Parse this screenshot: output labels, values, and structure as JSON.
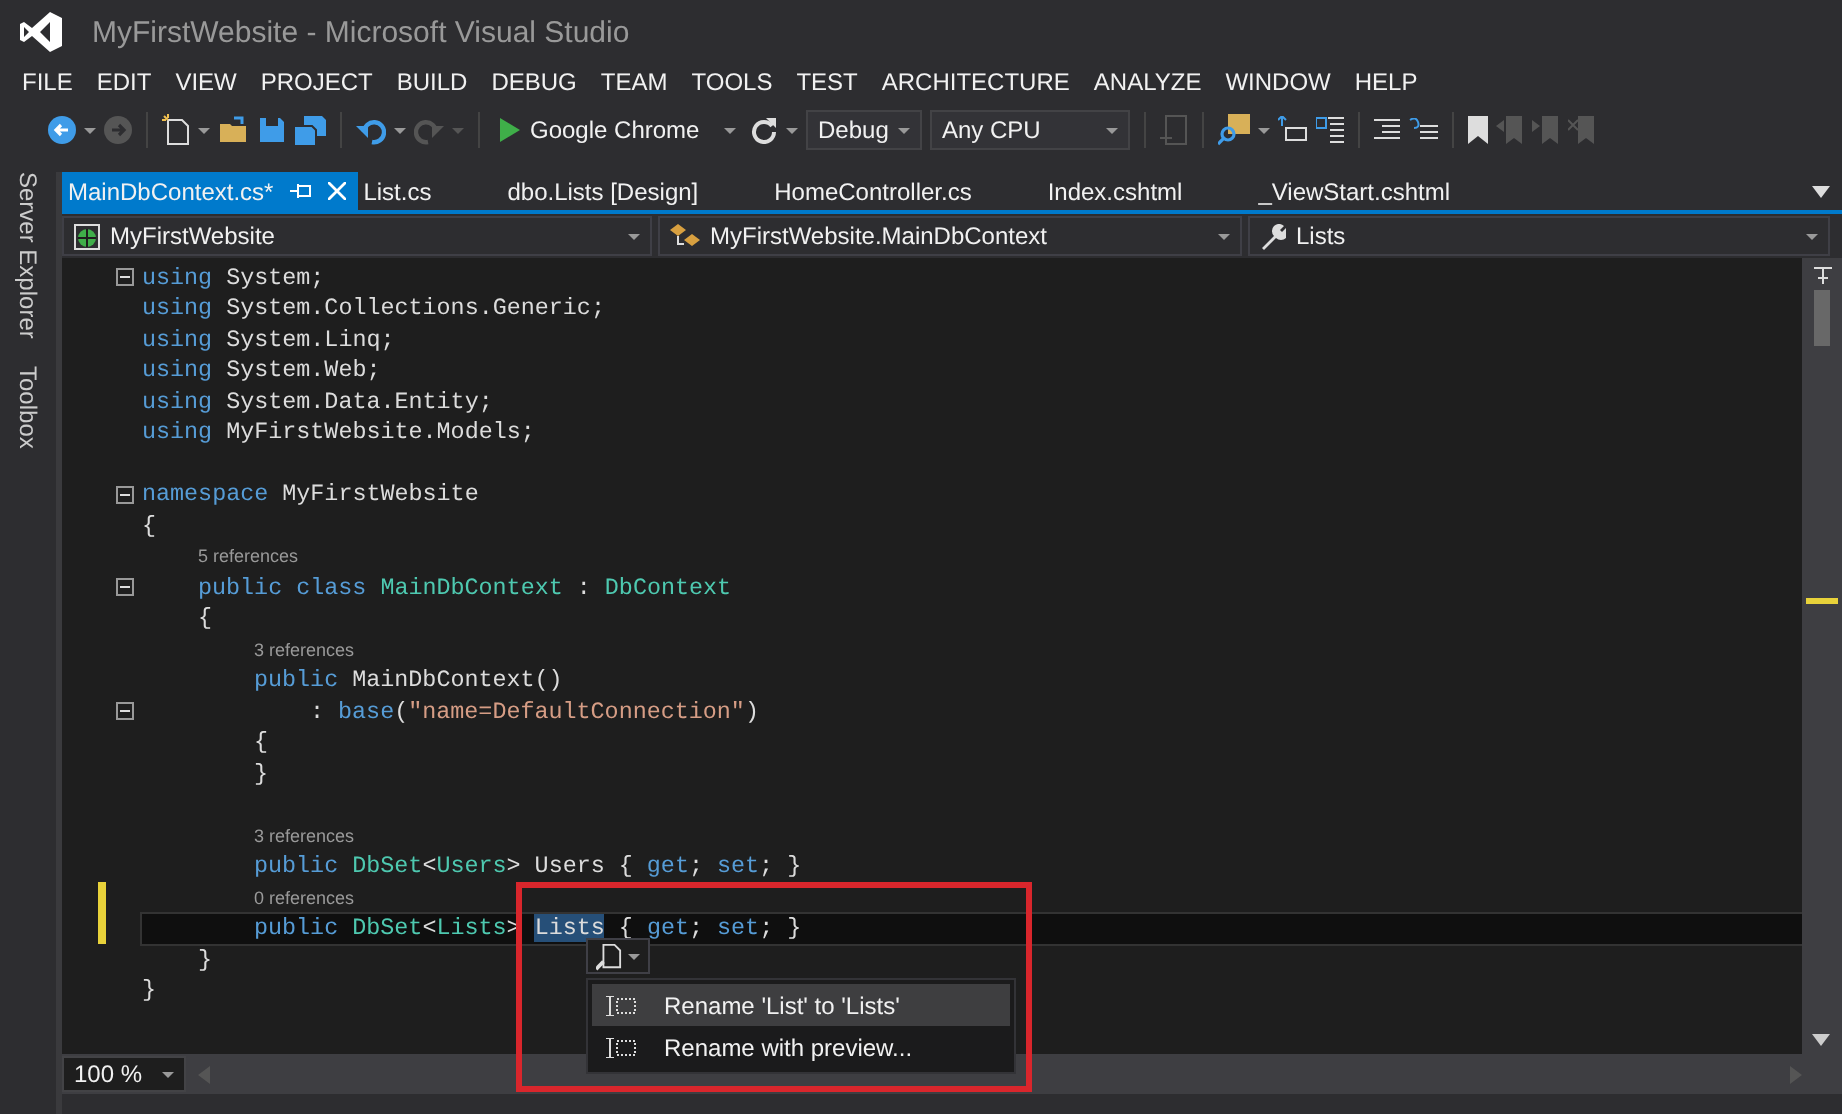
{
  "window": {
    "title": "MyFirstWebsite - Microsoft Visual Studio"
  },
  "menu": [
    "FILE",
    "EDIT",
    "VIEW",
    "PROJECT",
    "BUILD",
    "DEBUG",
    "TEAM",
    "TOOLS",
    "TEST",
    "ARCHITECTURE",
    "ANALYZE",
    "WINDOW",
    "HELP"
  ],
  "toolbar": {
    "run_target": "Google Chrome",
    "configuration": "Debug",
    "platform": "Any CPU"
  },
  "side_tabs": [
    "Server Explorer",
    "Toolbox"
  ],
  "tabs": [
    {
      "label": "MainDbContext.cs*",
      "selected": true
    },
    {
      "label": "List.cs",
      "selected": false
    },
    {
      "label": "dbo.Lists [Design]",
      "selected": false
    },
    {
      "label": "HomeController.cs",
      "selected": false
    },
    {
      "label": "Index.cshtml",
      "selected": false
    },
    {
      "label": "_ViewStart.cshtml",
      "selected": false
    }
  ],
  "navigation": {
    "project": "MyFirstWebsite",
    "type": "MyFirstWebsite.MainDbContext",
    "member": "Lists"
  },
  "editor": {
    "lines": [
      {
        "kind": "code",
        "fold": true,
        "modified": false,
        "current": false,
        "tokens": [
          {
            "kind": "kw",
            "text": "using"
          },
          {
            "kind": "plain",
            "text": " System;"
          }
        ]
      },
      {
        "kind": "code",
        "fold": false,
        "modified": false,
        "current": false,
        "tokens": [
          {
            "kind": "kw",
            "text": "using"
          },
          {
            "kind": "plain",
            "text": " System.Collections.Generic;"
          }
        ]
      },
      {
        "kind": "code",
        "fold": false,
        "modified": false,
        "current": false,
        "tokens": [
          {
            "kind": "kw",
            "text": "using"
          },
          {
            "kind": "plain",
            "text": " System.Linq;"
          }
        ]
      },
      {
        "kind": "code",
        "fold": false,
        "modified": false,
        "current": false,
        "tokens": [
          {
            "kind": "kw",
            "text": "using"
          },
          {
            "kind": "plain",
            "text": " System.Web;"
          }
        ]
      },
      {
        "kind": "code",
        "fold": false,
        "modified": false,
        "current": false,
        "tokens": [
          {
            "kind": "kw",
            "text": "using"
          },
          {
            "kind": "plain",
            "text": " System.Data.Entity;"
          }
        ]
      },
      {
        "kind": "code",
        "fold": false,
        "modified": false,
        "current": false,
        "tokens": [
          {
            "kind": "kw",
            "text": "using"
          },
          {
            "kind": "plain",
            "text": " MyFirstWebsite.Models;"
          }
        ]
      },
      {
        "kind": "blank"
      },
      {
        "kind": "code",
        "fold": true,
        "modified": false,
        "current": false,
        "tokens": [
          {
            "kind": "kw",
            "text": "namespace"
          },
          {
            "kind": "plain",
            "text": " MyFirstWebsite"
          }
        ]
      },
      {
        "kind": "code",
        "fold": false,
        "modified": false,
        "current": false,
        "tokens": [
          {
            "kind": "plain",
            "text": "{"
          }
        ]
      },
      {
        "kind": "block",
        "children": [
          {
            "kind": "lens",
            "text": "5 references",
            "modified": false
          },
          {
            "kind": "code",
            "fold": true,
            "modified": false,
            "current": false,
            "tokens": [
              {
                "kind": "kw",
                "text": "public class "
              },
              {
                "kind": "type",
                "text": "MainDbContext"
              },
              {
                "kind": "plain",
                "text": " : "
              },
              {
                "kind": "type",
                "text": "DbContext"
              }
            ]
          },
          {
            "kind": "code",
            "fold": false,
            "modified": false,
            "current": false,
            "tokens": [
              {
                "kind": "plain",
                "text": "{"
              }
            ]
          },
          {
            "kind": "block",
            "children": [
              {
                "kind": "lens",
                "text": "3 references",
                "modified": false
              },
              {
                "kind": "code",
                "fold": false,
                "modified": false,
                "current": false,
                "tokens": [
                  {
                    "kind": "kw",
                    "text": "public"
                  },
                  {
                    "kind": "plain",
                    "text": " MainDbContext()"
                  }
                ]
              },
              {
                "kind": "block",
                "children": [
                  {
                    "kind": "code",
                    "fold": true,
                    "modified": false,
                    "current": false,
                    "tokens": [
                      {
                        "kind": "plain",
                        "text": ": "
                      },
                      {
                        "kind": "kw",
                        "text": "base"
                      },
                      {
                        "kind": "plain",
                        "text": "("
                      },
                      {
                        "kind": "str",
                        "text": "\"name=DefaultConnection\""
                      },
                      {
                        "kind": "plain",
                        "text": ")"
                      }
                    ]
                  }
                ]
              },
              {
                "kind": "code",
                "fold": false,
                "modified": false,
                "current": false,
                "tokens": [
                  {
                    "kind": "plain",
                    "text": "{"
                  }
                ]
              },
              {
                "kind": "code",
                "fold": false,
                "modified": false,
                "current": false,
                "tokens": [
                  {
                    "kind": "plain",
                    "text": "}"
                  }
                ]
              },
              {
                "kind": "blank"
              },
              {
                "kind": "lens",
                "text": "3 references",
                "modified": false
              },
              {
                "kind": "code",
                "fold": false,
                "modified": false,
                "current": false,
                "tokens": [
                  {
                    "kind": "kw",
                    "text": "public "
                  },
                  {
                    "kind": "type",
                    "text": "DbSet"
                  },
                  {
                    "kind": "plain",
                    "text": "<"
                  },
                  {
                    "kind": "type",
                    "text": "Users"
                  },
                  {
                    "kind": "plain",
                    "text": "> Users { "
                  },
                  {
                    "kind": "kw",
                    "text": "get"
                  },
                  {
                    "kind": "plain",
                    "text": "; "
                  },
                  {
                    "kind": "kw",
                    "text": "set"
                  },
                  {
                    "kind": "plain",
                    "text": "; }"
                  }
                ]
              },
              {
                "kind": "lens",
                "text": "0 references",
                "modified": true
              },
              {
                "kind": "code",
                "fold": false,
                "modified": true,
                "current": true,
                "tokens": [
                  {
                    "kind": "kw",
                    "text": "public "
                  },
                  {
                    "kind": "type",
                    "text": "DbSet"
                  },
                  {
                    "kind": "plain",
                    "text": "<"
                  },
                  {
                    "kind": "type",
                    "text": "Lists"
                  },
                  {
                    "kind": "plain",
                    "text": "> "
                  },
                  {
                    "kind": "selected",
                    "text": "Lists"
                  },
                  {
                    "kind": "plain",
                    "text": " { "
                  },
                  {
                    "kind": "kw",
                    "text": "get"
                  },
                  {
                    "kind": "plain",
                    "text": "; "
                  },
                  {
                    "kind": "kw",
                    "text": "set"
                  },
                  {
                    "kind": "plain",
                    "text": "; }"
                  }
                ]
              }
            ]
          },
          {
            "kind": "code",
            "fold": false,
            "modified": false,
            "current": false,
            "tokens": [
              {
                "kind": "plain",
                "text": "}"
              }
            ]
          }
        ]
      },
      {
        "kind": "code",
        "fold": false,
        "modified": false,
        "current": false,
        "tokens": [
          {
            "kind": "plain",
            "text": "}"
          }
        ]
      }
    ]
  },
  "quick_actions": {
    "items": [
      {
        "label": "Rename 'List' to 'Lists'",
        "selected": true
      },
      {
        "label": "Rename with preview...",
        "selected": false
      }
    ]
  },
  "zoom": "100 %"
}
